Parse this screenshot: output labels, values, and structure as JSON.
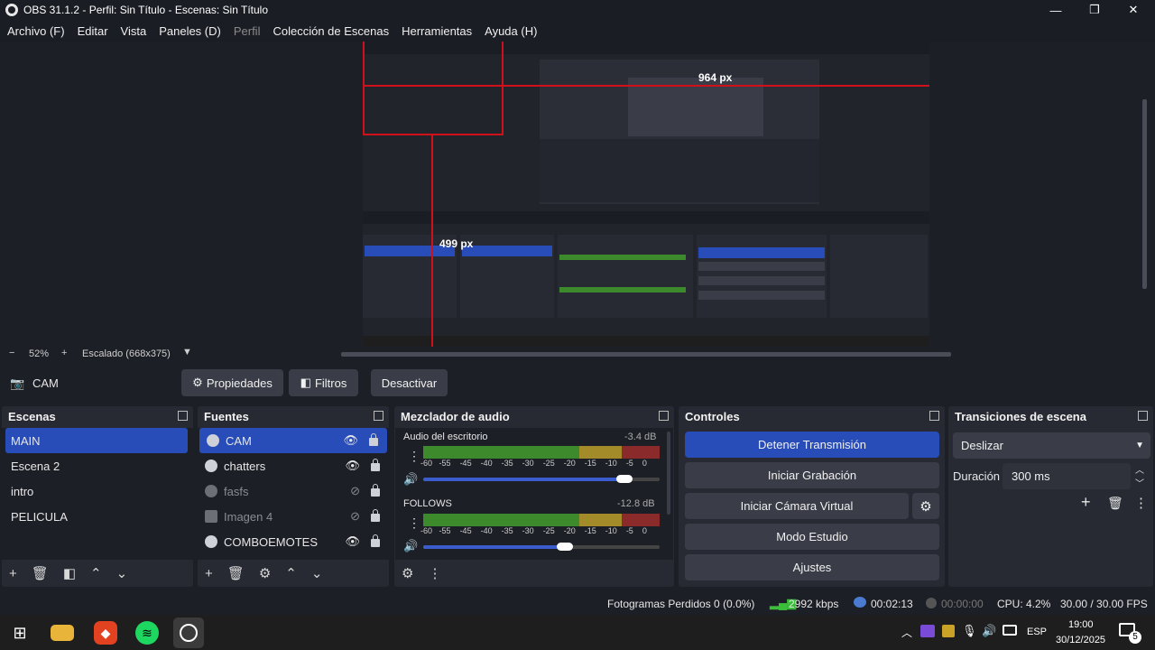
{
  "window": {
    "title": "OBS 31.1.2 - Perfil: Sin Título - Escenas: Sin Título",
    "minimize": "—",
    "restore": "❐",
    "close": "✕"
  },
  "menu": [
    "Archivo (F)",
    "Editar",
    "Vista",
    "Paneles (D)",
    "Perfil",
    "Colección de Escenas",
    "Herramientas",
    "Ayuda (H)"
  ],
  "preview": {
    "measure_top": "964 px",
    "measure_left": "499 px",
    "zoom": "52%",
    "scale_label": "Escalado (668x375)"
  },
  "source_toolbar": {
    "selected": "CAM",
    "properties": "Propiedades",
    "filters": "Filtros",
    "deactivate": "Desactivar"
  },
  "scenes": {
    "title": "Escenas",
    "items": [
      "MAIN",
      "Escena 2",
      "intro",
      "PELICULA"
    ]
  },
  "sources": {
    "title": "Fuentes",
    "items": [
      {
        "name": "CAM",
        "visible": true,
        "icon": "camera-icon"
      },
      {
        "name": "chatters",
        "visible": true,
        "icon": "browser-icon"
      },
      {
        "name": "fasfs",
        "visible": false,
        "icon": "game-icon"
      },
      {
        "name": "Imagen 4",
        "visible": false,
        "icon": "image-icon"
      },
      {
        "name": "COMBOEMOTES",
        "visible": true,
        "icon": "browser-icon"
      }
    ]
  },
  "mixer": {
    "title": "Mezclador de audio",
    "channels": [
      {
        "name": "Audio del escritorio",
        "db": "-3.4 dB",
        "volume": 0.85
      },
      {
        "name": "FOLLOWS",
        "db": "-12.8 dB",
        "volume": 0.6
      }
    ],
    "scale": [
      "-60",
      "-55",
      "-45",
      "-40",
      "-35",
      "-30",
      "-25",
      "-20",
      "-15",
      "-10",
      "-5",
      "0"
    ]
  },
  "controls": {
    "title": "Controles",
    "buttons": [
      "Detener Transmisión",
      "Iniciar Grabación",
      "Iniciar Cámara Virtual",
      "Modo Estudio",
      "Ajustes"
    ]
  },
  "transitions": {
    "title": "Transiciones de escena",
    "selected": "Deslizar",
    "duration_label": "Duración",
    "duration": "300 ms"
  },
  "status": {
    "dropped": "Fotogramas Perdidos 0 (0.0%)",
    "bitrate": "2992 kbps",
    "live_time": "00:02:13",
    "rec_time": "00:00:00",
    "cpu": "CPU: 4.2%",
    "fps": "30.00 / 30.00 FPS"
  },
  "taskbar": {
    "lang": "ESP",
    "time": "19:00",
    "date": "30/12/2025",
    "notif_count": "5"
  }
}
